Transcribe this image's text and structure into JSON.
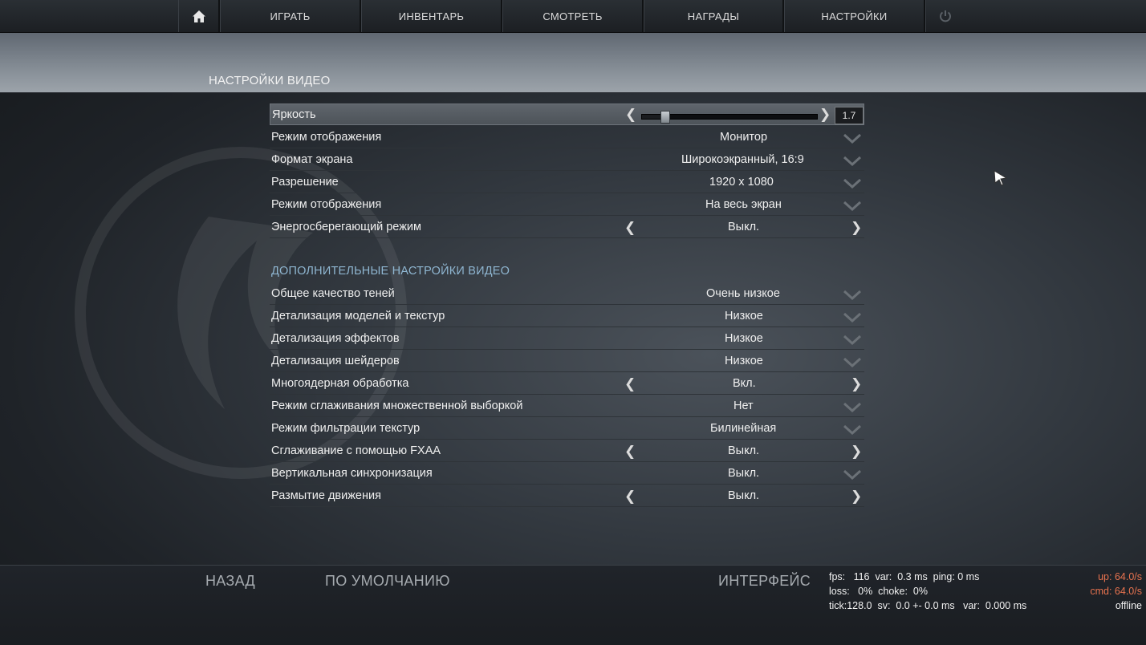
{
  "nav": {
    "home_icon": "home-icon",
    "items": [
      "ИГРАТЬ",
      "ИНВЕНТАРЬ",
      "СМОТРЕТЬ",
      "НАГРАДЫ",
      "НАСТРОЙКИ"
    ],
    "power_icon": "power-icon"
  },
  "page_title": "НАСТРОЙКИ ВИДЕО",
  "brightness": {
    "label": "Яркость",
    "value": "1.7",
    "slider_fraction": 0.13
  },
  "basic_settings": [
    {
      "label": "Режим отображения",
      "value": "Монитор",
      "control": "dropdown"
    },
    {
      "label": "Формат экрана",
      "value": "Широкоэкранный, 16:9",
      "control": "dropdown"
    },
    {
      "label": "Разрешение",
      "value": "1920 x 1080",
      "control": "dropdown"
    },
    {
      "label": "Режим отображения",
      "value": "На весь экран",
      "control": "dropdown"
    },
    {
      "label": "Энергосберегающий режим",
      "value": "Выкл.",
      "control": "toggle"
    }
  ],
  "advanced_section_title": "ДОПОЛНИТЕЛЬНЫЕ НАСТРОЙКИ ВИДЕО",
  "advanced_settings": [
    {
      "label": "Общее качество теней",
      "value": "Очень низкое",
      "control": "dropdown"
    },
    {
      "label": "Детализация моделей и текстур",
      "value": "Низкое",
      "control": "dropdown"
    },
    {
      "label": "Детализация эффектов",
      "value": "Низкое",
      "control": "dropdown"
    },
    {
      "label": "Детализация шейдеров",
      "value": "Низкое",
      "control": "dropdown"
    },
    {
      "label": "Многоядерная обработка",
      "value": "Вкл.",
      "control": "toggle"
    },
    {
      "label": "Режим сглаживания множественной выборкой",
      "value": "Нет",
      "control": "dropdown"
    },
    {
      "label": "Режим фильтрации текстур",
      "value": "Билинейная",
      "control": "dropdown"
    },
    {
      "label": "Сглаживание с помощью FXAA",
      "value": "Выкл.",
      "control": "toggle"
    },
    {
      "label": "Вертикальная синхронизация",
      "value": "Выкл.",
      "control": "dropdown"
    },
    {
      "label": "Размытие движения",
      "value": "Выкл.",
      "control": "toggle"
    }
  ],
  "bottom": {
    "back": "НАЗАД",
    "defaults": "ПО УМОЛЧАНИЮ",
    "interface": "ИНТЕРФЕЙС"
  },
  "netgraph": {
    "line1": "fps:   116  var:  0.3 ms  ping: 0 ms",
    "line2": "loss:   0%  choke:  0%",
    "line3": "tick:128.0  sv:  0.0 +- 0.0 ms   var:  0.000 ms",
    "up": "up: 64.0/s",
    "cmd": "cmd: 64.0/s",
    "status": "offline"
  },
  "colors": {
    "section_title": "#8fb6d1",
    "net_red": "#e8734f"
  }
}
